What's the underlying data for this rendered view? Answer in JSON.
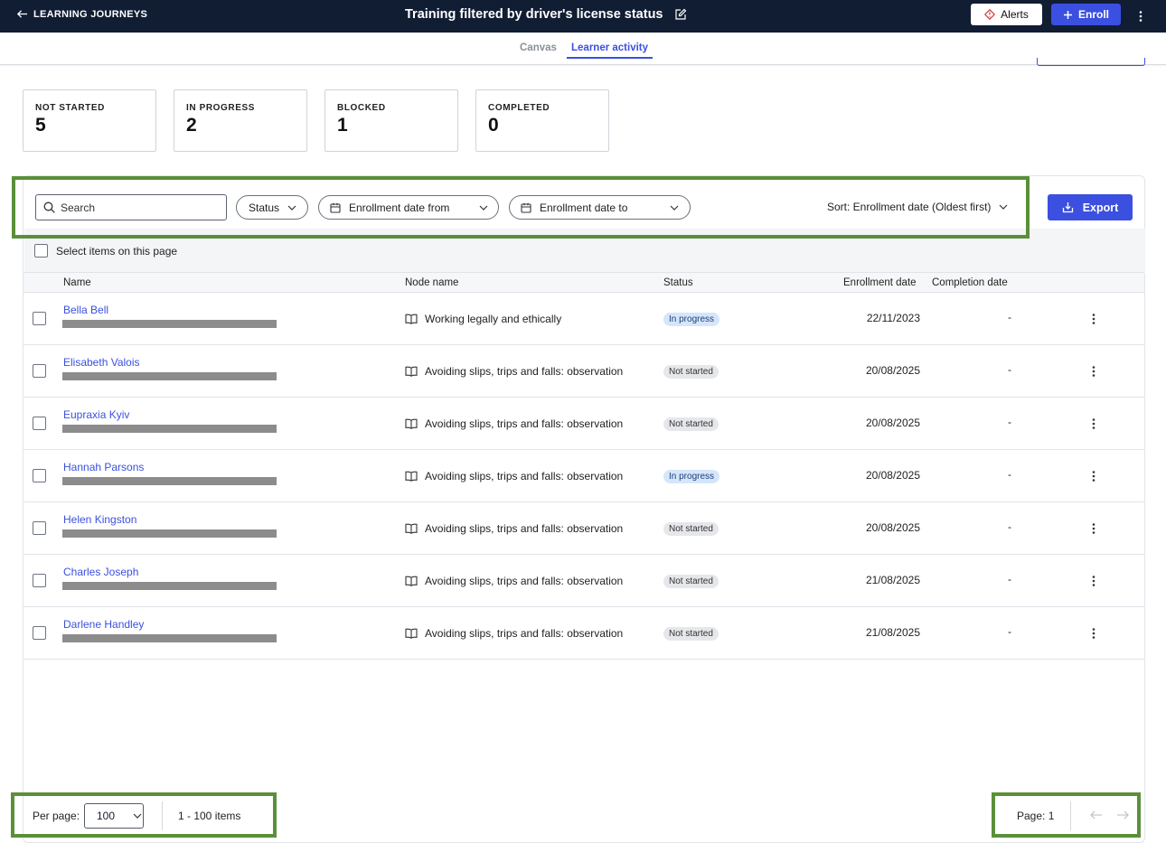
{
  "header": {
    "back_label": "LEARNING JOURNEYS",
    "title": "Training filtered by driver's license status",
    "alerts_label": "Alerts",
    "enroll_label": "Enroll"
  },
  "tabs": [
    {
      "label": "Canvas",
      "active": false
    },
    {
      "label": "Learner activity",
      "active": true
    }
  ],
  "stats": [
    {
      "label": "NOT STARTED",
      "value": "5"
    },
    {
      "label": "IN PROGRESS",
      "value": "2"
    },
    {
      "label": "BLOCKED",
      "value": "1"
    },
    {
      "label": "COMPLETED",
      "value": "0"
    }
  ],
  "filters": {
    "search_placeholder": "Search",
    "status_label": "Status",
    "date_from_label": "Enrollment date from",
    "date_to_label": "Enrollment date to",
    "sort_label": "Sort: Enrollment date (Oldest first)",
    "export_label": "Export",
    "select_all_label": "Select items on this page"
  },
  "table": {
    "columns": [
      "Name",
      "Node name",
      "Status",
      "Enrollment date",
      "Completion date"
    ],
    "rows": [
      {
        "name": "Bella Bell",
        "node": "Working legally and ethically",
        "status": "In progress",
        "status_kind": "progress",
        "enrolled": "22/11/2023",
        "completed": "-"
      },
      {
        "name": "Elisabeth Valois",
        "node": "Avoiding slips, trips and falls: observation",
        "status": "Not started",
        "status_kind": "notstarted",
        "enrolled": "20/08/2025",
        "completed": "-"
      },
      {
        "name": "Eupraxia Kyiv",
        "node": "Avoiding slips, trips and falls: observation",
        "status": "Not started",
        "status_kind": "notstarted",
        "enrolled": "20/08/2025",
        "completed": "-"
      },
      {
        "name": "Hannah Parsons",
        "node": "Avoiding slips, trips and falls: observation",
        "status": "In progress",
        "status_kind": "progress",
        "enrolled": "20/08/2025",
        "completed": "-"
      },
      {
        "name": "Helen Kingston",
        "node": "Avoiding slips, trips and falls: observation",
        "status": "Not started",
        "status_kind": "notstarted",
        "enrolled": "20/08/2025",
        "completed": "-"
      },
      {
        "name": "Charles Joseph",
        "node": "Avoiding slips, trips and falls: observation",
        "status": "Not started",
        "status_kind": "notstarted",
        "enrolled": "21/08/2025",
        "completed": "-"
      },
      {
        "name": "Darlene Handley",
        "node": "Avoiding slips, trips and falls: observation",
        "status": "Not started",
        "status_kind": "notstarted",
        "enrolled": "21/08/2025",
        "completed": "-"
      }
    ]
  },
  "footer": {
    "per_page_label": "Per page:",
    "per_page_value": "100",
    "range_label": "1 - 100 items",
    "page_label": "Page: 1"
  },
  "colors": {
    "accent": "#3b50e0",
    "header_bg": "#111d33",
    "highlight_border": "#5b8f3a"
  }
}
